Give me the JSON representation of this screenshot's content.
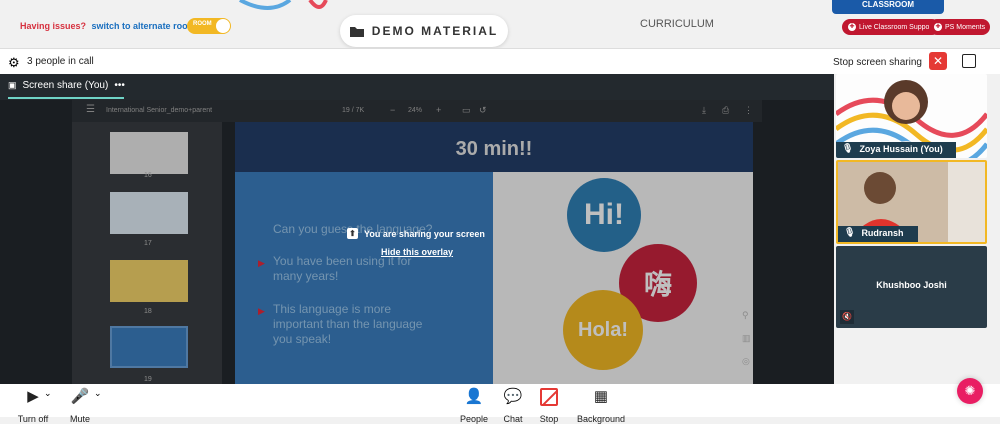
{
  "topbar": {
    "issue_text": "Having issues?",
    "alternate_link": "switch to alternate room",
    "toggle_label": "ROOM",
    "demo_button": "DEMO MATERIAL",
    "curriculum": "CURRICULUM",
    "classroom_tag": "CLASSROOM",
    "live_support": "Live Classroom Support",
    "ps_moments": "PS Moments"
  },
  "callbar": {
    "people_count": "3 people in call",
    "stop_sharing": "Stop screen sharing"
  },
  "stage": {
    "share_tab": "Screen share (You)",
    "more": "•••",
    "pdf": {
      "file_name": "International Senior_demo+parent",
      "page": "19 / 7K",
      "zoom": "24%"
    },
    "thumb_numbers": [
      "16",
      "17",
      "18",
      "19"
    ],
    "slide": {
      "heading_line2": "30 min!!",
      "question": "Can you guess the language?",
      "bullet1": "You have been using it for many years!",
      "bullet2": "This language is more important than the language you speak!",
      "bubble_hi": "Hi!",
      "bubble_chinese": "嗨",
      "bubble_hola": "Hola!"
    },
    "overlay": {
      "message": "You are sharing your screen",
      "hide_link": "Hide this overlay"
    }
  },
  "participants": [
    {
      "name": "Zoya Hussain (You)",
      "mic": "on"
    },
    {
      "name": "Rudransh",
      "mic": "on"
    },
    {
      "name": "Khushboo Joshi",
      "mic": "muted"
    }
  ],
  "bottombar": {
    "camera": "Turn off",
    "mic": "Mute",
    "people": "People",
    "chat": "Chat",
    "stop": "Stop",
    "background": "Background"
  },
  "colors": {
    "accent_red": "#c0172f",
    "share_underline": "#6fd3c7",
    "active_tile_border": "#f2b824"
  }
}
